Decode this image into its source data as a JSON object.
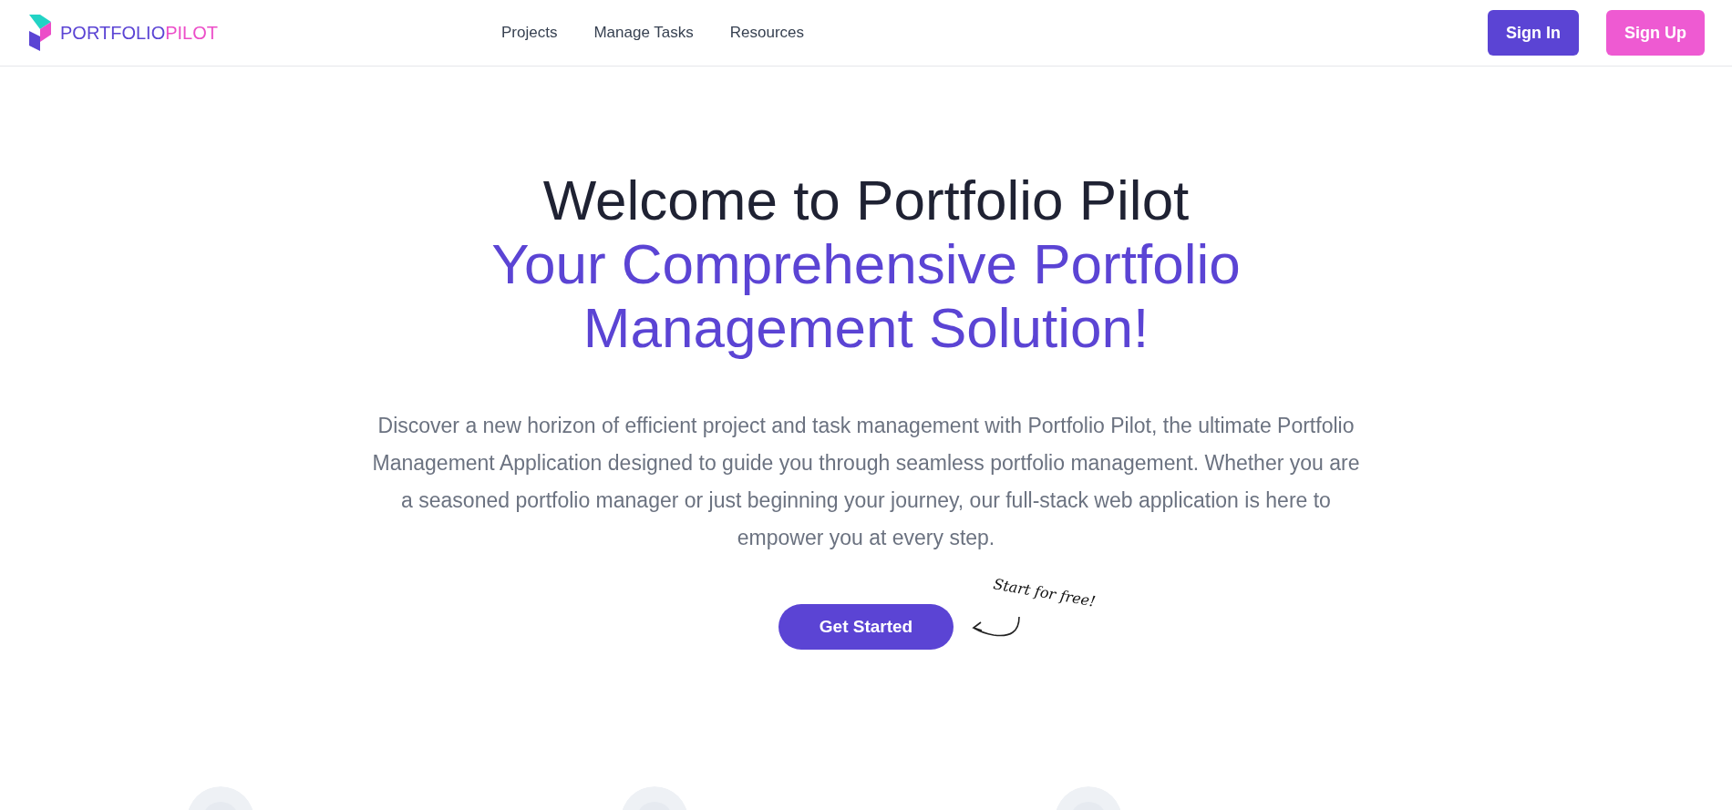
{
  "header": {
    "logo": {
      "part_1": "PORTFOLIO",
      "part_2": "PILOT"
    },
    "nav": [
      {
        "label": "Projects"
      },
      {
        "label": "Manage Tasks"
      },
      {
        "label": "Resources"
      }
    ],
    "buttons": [
      {
        "label": "Sign In",
        "kind": "primary"
      },
      {
        "label": "Sign Up",
        "kind": "accent"
      }
    ]
  },
  "hero": {
    "title": "Welcome to Portfolio Pilot",
    "subtitle": "Your Comprehensive Portfolio Management Solution!",
    "description": "Discover a new horizon of efficient project and task management with Portfolio Pilot, the ultimate Portfolio Management Application designed to guide you through seamless portfolio management. Whether you are a seasoned portfolio manager or just beginning your journey, our full-stack web application is here to empower you at every step.",
    "cta": "Get Started",
    "note": "Start for free!"
  }
}
